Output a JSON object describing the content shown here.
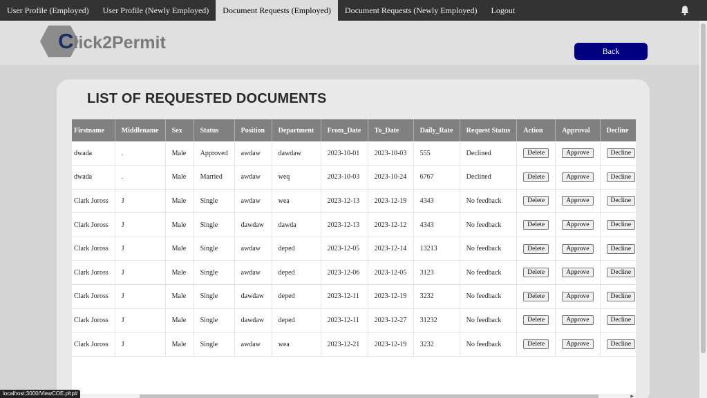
{
  "nav": {
    "items": [
      {
        "label": "User Profile (Employed)",
        "active": false
      },
      {
        "label": "User Profile (Newly Employed)",
        "active": false
      },
      {
        "label": "Document Requests (Employed)",
        "active": true
      },
      {
        "label": "Document Requests (Newly Employed)",
        "active": false
      },
      {
        "label": "Logout",
        "active": false
      }
    ],
    "bell_icon": "bell-icon"
  },
  "logo": {
    "first_letter": "C",
    "rest": "lick2Permit"
  },
  "back_label": "Back",
  "page_title": "LIST OF REQUESTED DOCUMENTS",
  "table": {
    "headers": [
      "Firstname",
      "Middlename",
      "Sex",
      "Status",
      "Position",
      "Department",
      "From_Date",
      "To_Date",
      "Daily_Rate",
      "Request Status",
      "Action",
      "Approval",
      "Decline"
    ],
    "rows": [
      [
        "dwada",
        ".",
        "Male",
        "Approved",
        "awdaw",
        "dawdaw",
        "2023-10-01",
        "2023-10-03",
        "555",
        "Declined"
      ],
      [
        "dwada",
        ".",
        "Male",
        "Married",
        "awdaw",
        "weq",
        "2023-10-03",
        "2023-10-24",
        "6767",
        "Declined"
      ],
      [
        "Clark Joross",
        "J",
        "Male",
        "Single",
        "awdaw",
        "wea",
        "2023-12-13",
        "2023-12-19",
        "4343",
        "No feedback"
      ],
      [
        "Clark Joross",
        "J",
        "Male",
        "Single",
        "dawdaw",
        "dawda",
        "2023-12-13",
        "2023-12-12",
        "4343",
        "No feedback"
      ],
      [
        "Clark Joross",
        "J",
        "Male",
        "Single",
        "awdaw",
        "deped",
        "2023-12-05",
        "2023-12-14",
        "13213",
        "No feedback"
      ],
      [
        "Clark Joross",
        "J",
        "Male",
        "Single",
        "awdaw",
        "deped",
        "2023-12-06",
        "2023-12-05",
        "3123",
        "No feedback"
      ],
      [
        "Clark Joross",
        "J",
        "Male",
        "Single",
        "dawdaw",
        "deped",
        "2023-12-11",
        "2023-12-19",
        "3232",
        "No feedback"
      ],
      [
        "Clark Joross",
        "J",
        "Male",
        "Single",
        "dawdaw",
        "deped",
        "2023-12-11",
        "2023-12-27",
        "31232",
        "No feedback"
      ],
      [
        "Clark Joross",
        "J",
        "Male",
        "Single",
        "awdaw",
        "wea",
        "2023-12-21",
        "2023-12-19",
        "3232",
        "No feedback"
      ]
    ],
    "action_labels": {
      "delete": "Delete",
      "approve": "Approve",
      "decline": "Decline"
    }
  },
  "status_url": "localhost:3000/ViewCOE.php#",
  "colors": {
    "nav_bg": "#333333",
    "active_tab": "#dddddd",
    "back_btn": "#000080",
    "table_header": "#808080"
  }
}
